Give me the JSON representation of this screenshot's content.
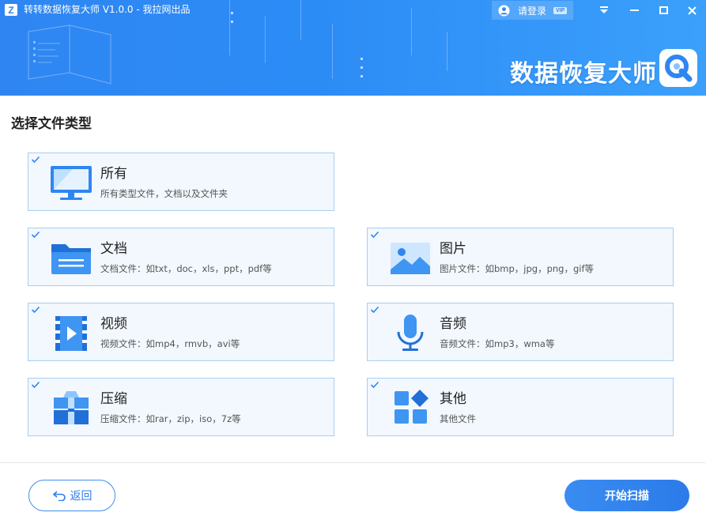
{
  "window": {
    "title": "转转数据恢复大师 V1.0.0 - 我拉网出品",
    "logo_letter": "Z",
    "login_label": "请登录",
    "vip_badge": "VIP",
    "brand_title": "数据恢复大师"
  },
  "main": {
    "section_title": "选择文件类型",
    "cards": [
      {
        "name": "所有",
        "desc": "所有类型文件，文档以及文件夹",
        "checked": true,
        "icon": "monitor-icon"
      },
      {
        "name": "文档",
        "desc": "文档文件：如txt，doc，xls，ppt，pdf等",
        "checked": true,
        "icon": "folder-icon"
      },
      {
        "name": "图片",
        "desc": "图片文件：如bmp，jpg，png，gif等",
        "checked": true,
        "icon": "image-icon"
      },
      {
        "name": "视频",
        "desc": "视频文件：如mp4，rmvb，avi等",
        "checked": true,
        "icon": "video-icon"
      },
      {
        "name": "音频",
        "desc": "音频文件：如mp3，wma等",
        "checked": true,
        "icon": "microphone-icon"
      },
      {
        "name": "压缩",
        "desc": "压缩文件：如rar，zip，iso，7z等",
        "checked": true,
        "icon": "archive-icon"
      },
      {
        "name": "其他",
        "desc": "其他文件",
        "checked": true,
        "icon": "apps-icon"
      }
    ]
  },
  "footer": {
    "back_label": "返回",
    "scan_label": "开始扫描"
  },
  "colors": {
    "accent": "#2f86f2",
    "card_bg": "#f2f8fe",
    "card_border": "#a9cdf1"
  }
}
